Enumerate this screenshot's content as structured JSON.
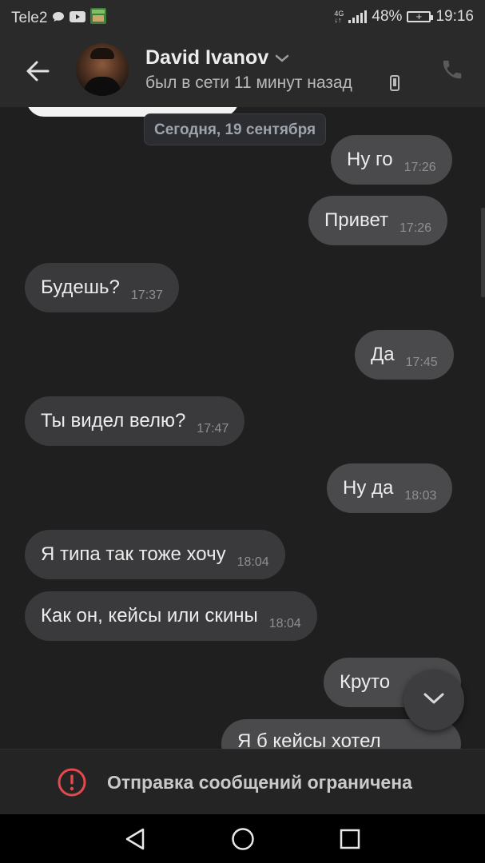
{
  "status_bar": {
    "carrier": "Tele2",
    "network": "4G",
    "battery_percent": "48%",
    "time": "19:16"
  },
  "header": {
    "contact_name": "David Ivanov",
    "last_seen": "был в сети 11 минут назад"
  },
  "chat": {
    "date_separator": "Сегодня, 19 сентября",
    "messages": [
      {
        "side": "out",
        "text": "Ну го",
        "time": "17:26"
      },
      {
        "side": "out",
        "text": "Привет",
        "time": "17:26"
      },
      {
        "side": "in",
        "text": "Будешь?",
        "time": "17:37"
      },
      {
        "side": "out",
        "text": "Да",
        "time": "17:45"
      },
      {
        "side": "in",
        "text": "Ты видел велю?",
        "time": "17:47"
      },
      {
        "side": "out",
        "text": "Ну да",
        "time": "18:03"
      },
      {
        "side": "in",
        "text": "Я типа так тоже хочу",
        "time": "18:04"
      },
      {
        "side": "in",
        "text": "Как он, кейсы или скины",
        "time": "18:04"
      },
      {
        "side": "out",
        "text": "Круто",
        "time": ""
      },
      {
        "side": "out",
        "text": "Я б кейсы хотел",
        "time": ""
      }
    ]
  },
  "footer": {
    "restricted_message": "Отправка сообщений ограничена"
  },
  "colors": {
    "background": "#1f1f1f",
    "header": "#2a2a2a",
    "bubble_in": "#3a3a3c",
    "bubble_out": "#4a4a4c",
    "warning": "#e5484d"
  }
}
